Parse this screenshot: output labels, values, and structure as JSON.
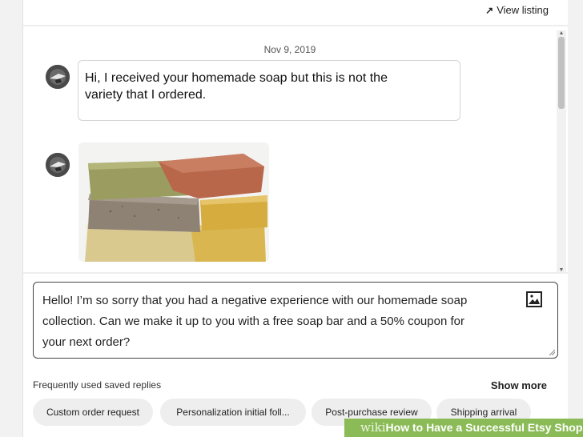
{
  "header": {
    "view_listing_label": "View listing"
  },
  "thread": {
    "date": "Nov 9, 2019",
    "messages": [
      {
        "type": "text",
        "text_line1": "Hi, I received your homemade soap but this is not the",
        "text_line2": "variety that I ordered."
      },
      {
        "type": "image",
        "content": "photo of stacked handmade soap bars"
      }
    ]
  },
  "reply": {
    "line1": "Hello! I’m so sorry that you had a negative experience with our homemade soap",
    "line2": "collection. Can we make it up to you with a free soap bar and a 50% coupon for",
    "line3": "your next order?"
  },
  "saved_replies": {
    "label": "Frequently used saved replies",
    "show_more": "Show more",
    "chips": [
      "Custom order request",
      "Personalization initial foll...",
      "Post-purchase review",
      "Shipping arrival"
    ]
  },
  "watermark": {
    "prefix": "wiki",
    "text": "How to Have a Successful Etsy Shop"
  },
  "colors": {
    "background": "#f2f2f2",
    "chip": "#eeeeee",
    "watermark": "#8bbb57"
  },
  "icons": {
    "view_listing": "arrow-up-right-icon",
    "image_attach": "image-icon",
    "scroll_up": "triangle-up",
    "scroll_down": "triangle-down"
  }
}
